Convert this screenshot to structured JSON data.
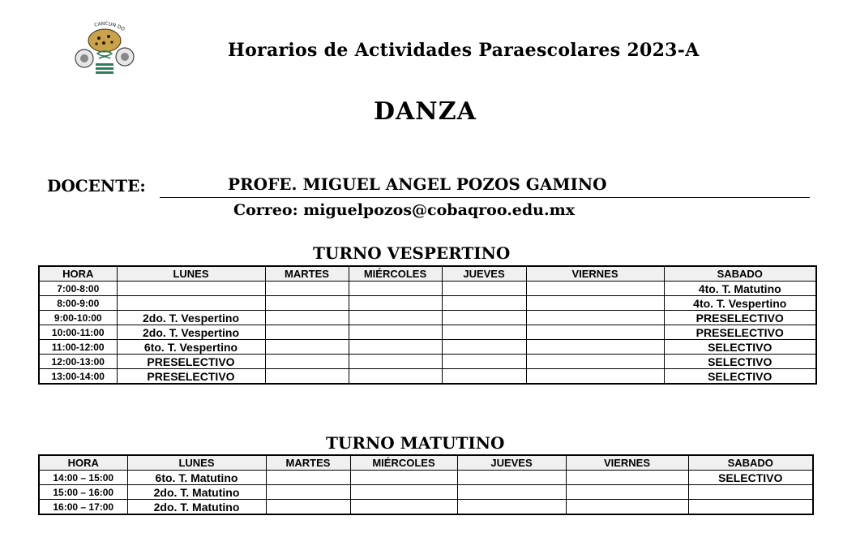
{
  "header": {
    "title": "Horarios de Actividades Paraescolares 2023-A",
    "subject": "DANZA",
    "teacher_label": "DOCENTE:",
    "teacher_name": "PROFE. MIGUEL ANGEL POZOS GAMINO",
    "email": "Correo: miguelpozos@cobaqroo.edu.mx",
    "logo_text": "CANCUN DOS"
  },
  "vespertino": {
    "title": "TURNO VESPERTINO",
    "columns": [
      "HORA",
      "LUNES",
      "MARTES",
      "MIÉRCOLES",
      "JUEVES",
      "VIERNES",
      "SABADO"
    ],
    "rows": [
      [
        "7:00-8:00",
        "",
        "",
        "",
        "",
        "",
        "4to. T. Matutino"
      ],
      [
        "8:00-9:00",
        "",
        "",
        "",
        "",
        "",
        "4to. T. Vespertino"
      ],
      [
        "9:00-10:00",
        "2do. T. Vespertino",
        "",
        "",
        "",
        "",
        "PRESELECTIVO"
      ],
      [
        "10:00-11:00",
        "2do. T. Vespertino",
        "",
        "",
        "",
        "",
        "PRESELECTIVO"
      ],
      [
        "11:00-12:00",
        "6to. T. Vespertino",
        "",
        "",
        "",
        "",
        "SELECTIVO"
      ],
      [
        "12:00-13:00",
        "PRESELECTIVO",
        "",
        "",
        "",
        "",
        "SELECTIVO"
      ],
      [
        "13:00-14:00",
        "PRESELECTIVO",
        "",
        "",
        "",
        "",
        "SELECTIVO"
      ]
    ]
  },
  "matutino": {
    "title": "TURNO MATUTINO",
    "columns": [
      "HORA",
      "LUNES",
      "MARTES",
      "MIÉRCOLES",
      "JUEVES",
      "VIERNES",
      "SABADO"
    ],
    "rows": [
      [
        "14:00 – 15:00",
        "6to. T. Matutino",
        "",
        "",
        "",
        "",
        "SELECTIVO"
      ],
      [
        "15:00 – 16:00",
        "2do. T. Matutino",
        "",
        "",
        "",
        "",
        ""
      ],
      [
        "16:00 – 17:00",
        "2do. T. Matutino",
        "",
        "",
        "",
        "",
        ""
      ]
    ]
  }
}
